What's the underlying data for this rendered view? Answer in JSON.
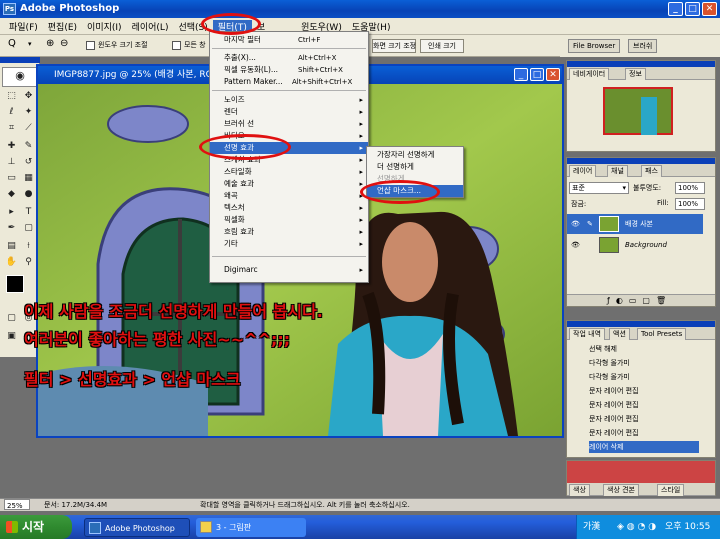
{
  "app": {
    "title": "Adobe Photoshop"
  },
  "menubar": {
    "items": [
      "파일(F)",
      "편집(E)",
      "이미지(I)",
      "레이어(L)",
      "선택(S)",
      "필터(T)",
      "보",
      "(W)",
      "윈도우(W)",
      "도움말(H)"
    ]
  },
  "options": {
    "zoom_label": "Q",
    "checkbox1": "윈도우 크기 조절",
    "checkbox2": "모든 창 확대/축소",
    "btn_actual": "실제 픽셀",
    "btn_fit": "화면 크기 조정",
    "btn_print": "인쇄 크기"
  },
  "palette_well": {
    "file_browser": "File Browser",
    "brushes": "브러쉬"
  },
  "document": {
    "title": "IMGP8877.jpg @ 25% (배경 사본, RGB)"
  },
  "filter_menu": {
    "items": [
      {
        "label": "마지막 필터",
        "shortcut": "Ctrl+F",
        "arrow": ""
      },
      {
        "label": "추출(X)...",
        "shortcut": "Alt+Ctrl+X",
        "arrow": ""
      },
      {
        "label": "픽셀 유동화(L)...",
        "shortcut": "Shift+Ctrl+X",
        "arrow": ""
      },
      {
        "label": "Pattern Maker...",
        "shortcut": "Alt+Shift+Ctrl+X",
        "arrow": ""
      },
      {
        "label": "노이즈",
        "shortcut": "",
        "arrow": "▸"
      },
      {
        "label": "렌더",
        "shortcut": "",
        "arrow": "▸"
      },
      {
        "label": "브러쉬 선",
        "shortcut": "",
        "arrow": "▸"
      },
      {
        "label": "비디오",
        "shortcut": "",
        "arrow": "▸"
      },
      {
        "label": "선명 효과",
        "shortcut": "",
        "arrow": "▸"
      },
      {
        "label": "스케치 효과",
        "shortcut": "",
        "arrow": "▸"
      },
      {
        "label": "스타일화",
        "shortcut": "",
        "arrow": "▸"
      },
      {
        "label": "예술 효과",
        "shortcut": "",
        "arrow": "▸"
      },
      {
        "label": "왜곡",
        "shortcut": "",
        "arrow": "▸"
      },
      {
        "label": "텍스처",
        "shortcut": "",
        "arrow": "▸"
      },
      {
        "label": "픽셀화",
        "shortcut": "",
        "arrow": "▸"
      },
      {
        "label": "흐림 효과",
        "shortcut": "",
        "arrow": "▸"
      },
      {
        "label": "기타",
        "shortcut": "",
        "arrow": "▸"
      },
      {
        "label": "Digimarc",
        "shortcut": "",
        "arrow": "▸"
      }
    ]
  },
  "sharpen_submenu": {
    "items": [
      "가장자리 선명하게",
      "더 선명하게",
      "선명하게",
      "언샵 마스크..."
    ]
  },
  "navigator": {
    "tabs": [
      "네비게이터",
      "정보"
    ]
  },
  "layers": {
    "tabs": [
      "레이어",
      "채널",
      "패스"
    ],
    "blend_mode": "표준",
    "opacity_label": "불투명도:",
    "opacity": "100%",
    "fill_label": "Fill:",
    "fill": "100%",
    "lock_label": "잠금:",
    "rows": [
      "배경 사본",
      "Background"
    ]
  },
  "history": {
    "tabs": [
      "작업 내역",
      "액션",
      "Tool Presets"
    ],
    "rows": [
      "선택 해제",
      "다각형 올가미",
      "다각형 올가미",
      "문자 레이어 편집",
      "문자 레이어 편집",
      "문자 레이어 편집",
      "문자 레이어 편집",
      "레이어 삭제"
    ]
  },
  "bottom_tabs": [
    "색상",
    "색상 견본",
    "스타일"
  ],
  "status": {
    "zoom": "25%",
    "doc": "문서: 17.2M/34.4M",
    "hint": "확대할 영역을 클릭하거나 드래그하십시오. Alt 키를 눌러 축소하십시오."
  },
  "captions": [
    "이제 사람을 조금더 선명하게 만들어 봅시다.",
    "여러분이 좋아하는 평한 사진~~^^;;;",
    "필터 > 선명효과 > 언샵 마스크"
  ],
  "taskbar": {
    "start": "시작",
    "task1": "Adobe Photoshop",
    "task2": "3 - 그림판",
    "ime": "가漢",
    "clock": "오후 10:55"
  },
  "colors": {
    "accent": "#0a43c0",
    "highlight": "#e01010",
    "selection": "#316ac5"
  }
}
